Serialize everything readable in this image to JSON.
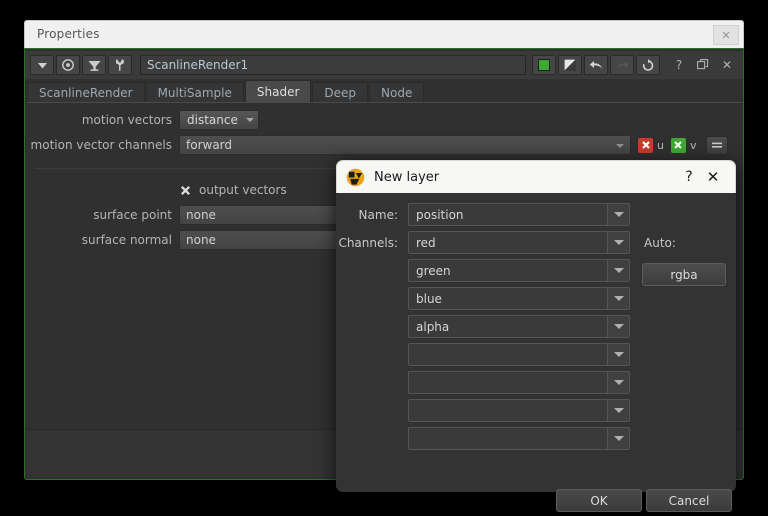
{
  "properties_panel": {
    "title": "Properties",
    "close_icon": "close-icon",
    "toolbar": {
      "menu_icon": "chevron-down-icon",
      "target_icon": "target-icon",
      "viewer_icon": "monitor-icon",
      "wrench_icon": "wrench-icon",
      "node_name": "ScanlineRender1",
      "color_swatch_icon": "color-swatch-icon",
      "bw_swatch_icon": "bw-swatch-icon",
      "undo_icon": "undo-icon",
      "redo_icon": "redo-icon",
      "revert_icon": "revert-icon",
      "help_label": "?",
      "float_icon": "float-window-icon",
      "close_label": "✕"
    },
    "tabs": [
      {
        "label": "ScanlineRender",
        "active": false
      },
      {
        "label": "MultiSample",
        "active": false
      },
      {
        "label": "Shader",
        "active": true
      },
      {
        "label": "Deep",
        "active": false
      },
      {
        "label": "Node",
        "active": false
      }
    ],
    "knobs": {
      "motion_vectors_label": "motion vectors",
      "motion_vectors_value": "distance",
      "motion_vector_channels_label": "motion vector channels",
      "motion_vector_channels_value": "forward",
      "channel_u_label": "u",
      "channel_v_label": "v",
      "channel_u_color": "#c63d2e",
      "channel_v_color": "#3fa832",
      "equals_button_icon": "equals-icon",
      "output_vectors_label": "output vectors",
      "output_vectors_checked": true,
      "surface_point_label": "surface point",
      "surface_point_value": "none",
      "surface_normal_label": "surface normal",
      "surface_normal_value": "none"
    }
  },
  "new_layer_dialog": {
    "logo_icon": "nuke-logo-icon",
    "title": "New layer",
    "help_label": "?",
    "close_label": "✕",
    "name_label": "Name:",
    "name_value": "position",
    "channels_label": "Channels:",
    "auto_label": "Auto:",
    "rgba_button_label": "rgba",
    "channel_rows": [
      {
        "value": "red"
      },
      {
        "value": "green"
      },
      {
        "value": "blue"
      },
      {
        "value": "alpha"
      },
      {
        "value": ""
      },
      {
        "value": ""
      },
      {
        "value": ""
      },
      {
        "value": ""
      }
    ],
    "ok_label": "OK",
    "cancel_label": "Cancel"
  },
  "colors": {
    "accent_green": "#2d6f2d",
    "window_bg": "#303030",
    "dialog_bg": "#333333",
    "titlebar_light": "#f7f7f5",
    "nuke_logo_yellow": "#e8a317"
  }
}
